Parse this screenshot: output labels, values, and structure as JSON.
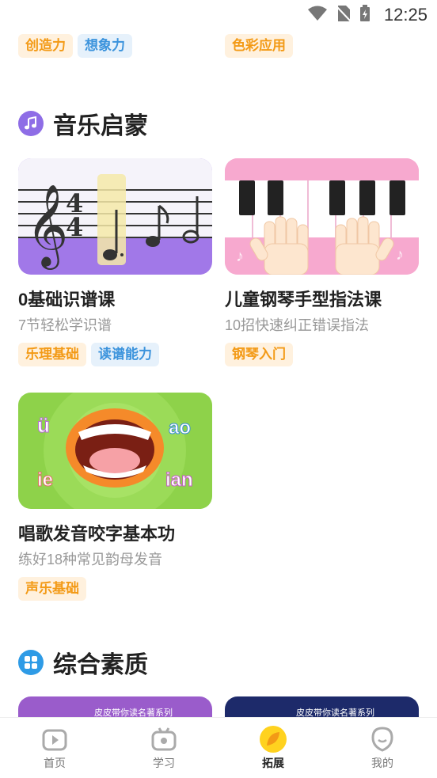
{
  "status": {
    "time": "12:25"
  },
  "top_tags": {
    "left": [
      {
        "label": "创造力",
        "color": "orange"
      },
      {
        "label": "想象力",
        "color": "blue"
      }
    ],
    "right": [
      {
        "label": "色彩应用",
        "color": "orange"
      }
    ]
  },
  "music": {
    "title": "音乐启蒙",
    "accent": "#8e6de6",
    "cards": [
      {
        "title": "0基础识谱课",
        "subtitle": "7节轻松学识谱",
        "tags": [
          {
            "label": "乐理基础",
            "color": "orange"
          },
          {
            "label": "读谱能力",
            "color": "blue"
          }
        ]
      },
      {
        "title": "儿童钢琴手型指法课",
        "subtitle": "10招快速纠正错误指法",
        "tags": [
          {
            "label": "钢琴入门",
            "color": "orange"
          }
        ]
      },
      {
        "title": "唱歌发音咬字基本功",
        "subtitle": "练好18种常见韵母发音",
        "tags": [
          {
            "label": "声乐基础",
            "color": "orange"
          }
        ],
        "thumb_letters": {
          "tl": "ü",
          "tr": "ao",
          "bl": "ie",
          "br": "ian"
        }
      }
    ]
  },
  "general": {
    "title": "综合素质",
    "accent": "#2e9be6",
    "peek_cards": [
      {
        "caption": "皮皮带你读名著系列"
      },
      {
        "caption": "皮皮带你读名著系列"
      }
    ]
  },
  "tabbar": {
    "items": [
      {
        "label": "首页",
        "icon": "home-play-icon",
        "active": false
      },
      {
        "label": "学习",
        "icon": "tv-study-icon",
        "active": false
      },
      {
        "label": "拓展",
        "icon": "leaf-icon",
        "active": true
      },
      {
        "label": "我的",
        "icon": "profile-face-icon",
        "active": false
      }
    ]
  }
}
